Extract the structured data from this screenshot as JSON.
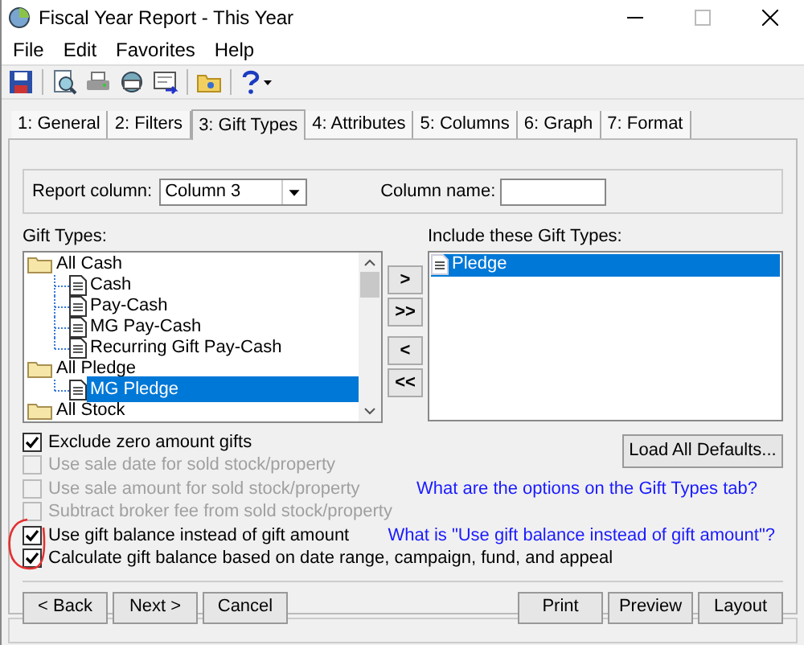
{
  "window": {
    "title": "Fiscal Year Report - This Year"
  },
  "menu": [
    "File",
    "Edit",
    "Favorites",
    "Help"
  ],
  "toolbar": [
    {
      "kind": "save"
    },
    {
      "kind": "sep"
    },
    {
      "kind": "preview"
    },
    {
      "kind": "print"
    },
    {
      "kind": "email"
    },
    {
      "kind": "export"
    },
    {
      "kind": "sep"
    },
    {
      "kind": "folder"
    },
    {
      "kind": "sep"
    },
    {
      "kind": "help"
    }
  ],
  "tabs": [
    {
      "label": "1: General",
      "selected": false
    },
    {
      "label": "2: Filters",
      "selected": false
    },
    {
      "label": "3: Gift Types",
      "selected": true
    },
    {
      "label": "4: Attributes",
      "selected": false
    },
    {
      "label": "5: Columns",
      "selected": false
    },
    {
      "label": "6: Graph",
      "selected": false
    },
    {
      "label": "7: Format",
      "selected": false
    }
  ],
  "report_column": {
    "label": "Report column:",
    "value": "Column 3"
  },
  "column_name": {
    "label": "Column name:"
  },
  "gift_types": {
    "label": "Gift Types:",
    "items": [
      {
        "label": "All Cash",
        "kind": "folder",
        "selected": false,
        "children": [
          {
            "label": "Cash",
            "kind": "document",
            "selected": false
          },
          {
            "label": "Pay-Cash",
            "kind": "document",
            "selected": false
          },
          {
            "label": "MG Pay-Cash",
            "kind": "document",
            "selected": false
          },
          {
            "label": "Recurring Gift Pay-Cash",
            "kind": "document",
            "selected": false
          }
        ]
      },
      {
        "label": "All Pledge",
        "kind": "folder",
        "selected": false,
        "children": [
          {
            "label": "MG Pledge",
            "kind": "document",
            "selected": true
          }
        ]
      },
      {
        "label": "All Stock",
        "kind": "folder",
        "selected": false
      }
    ]
  },
  "move_buttons": [
    ">",
    ">>",
    "<",
    "<<"
  ],
  "include": {
    "label": "Include these Gift Types:",
    "items": [
      {
        "label": "Pledge",
        "selected": true
      }
    ]
  },
  "options": [
    {
      "label": "Exclude zero amount gifts",
      "checked": true,
      "disabled": false
    },
    {
      "label": "Use sale date for sold stock/property",
      "checked": false,
      "disabled": true
    },
    {
      "label": "Use sale amount for sold stock/property",
      "checked": false,
      "disabled": true
    },
    {
      "label": "Subtract broker fee from sold stock/property",
      "checked": false,
      "disabled": true
    },
    {
      "label": "Use gift balance instead of gift amount",
      "checked": true,
      "disabled": false
    },
    {
      "label": "Calculate gift balance based on date range, campaign, fund, and appeal",
      "checked": true,
      "disabled": false
    }
  ],
  "load_defaults": "Load All Defaults...",
  "links": [
    "What are the options on the Gift Types tab?",
    "What is \"Use gift balance instead of gift amount\"?"
  ],
  "nav_buttons": [
    "< Back",
    "Next >",
    "Cancel"
  ],
  "output_buttons": [
    "Print",
    "Preview",
    "Layout"
  ],
  "annotation": {
    "circle": true
  }
}
